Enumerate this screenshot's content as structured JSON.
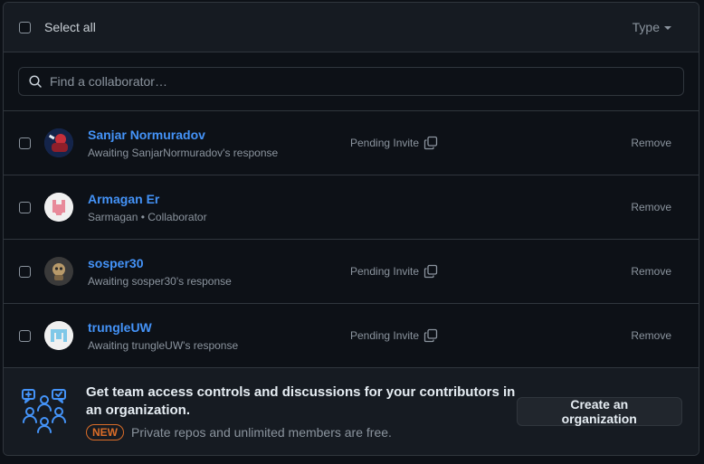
{
  "header": {
    "select_all_label": "Select all",
    "type_label": "Type"
  },
  "search": {
    "placeholder": "Find a collaborator…"
  },
  "collaborators": [
    {
      "name": "Sanjar Normuradov",
      "subtitle": "Awaiting SanjarNormuradov's response",
      "status": "Pending Invite",
      "action": "Remove"
    },
    {
      "name": "Armagan Er",
      "subtitle": "Sarmagan • Collaborator",
      "status": "",
      "action": "Remove"
    },
    {
      "name": "sosper30",
      "subtitle": "Awaiting sosper30's response",
      "status": "Pending Invite",
      "action": "Remove"
    },
    {
      "name": "trungleUW",
      "subtitle": "Awaiting trungleUW's response",
      "status": "Pending Invite",
      "action": "Remove"
    }
  ],
  "promo": {
    "title": "Get team access controls and discussions for your contributors in an organization.",
    "badge": "NEW",
    "subtitle": "Private repos and unlimited members are free.",
    "button_label": "Create an organization"
  },
  "colors": {
    "link": "#4493f8",
    "badge": "#db6d28",
    "promo_icon": "#4493f8"
  }
}
